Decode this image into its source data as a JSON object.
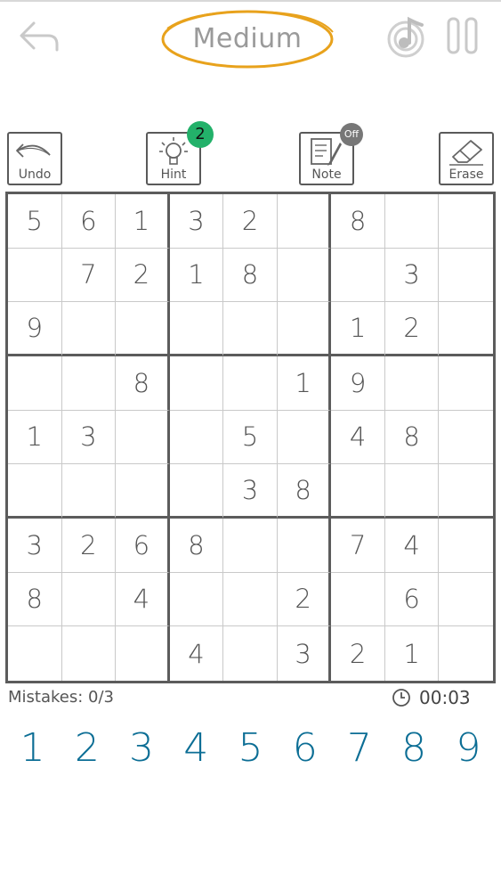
{
  "header": {
    "difficulty": "Medium",
    "accent_color": "#e8a21c",
    "icons": [
      "back-arrow-icon",
      "music-note-icon",
      "pause-icon"
    ]
  },
  "toolbar": {
    "undo_label": "Undo",
    "hint_label": "Hint",
    "hint_count": "2",
    "note_label": "Note",
    "note_state": "Off",
    "erase_label": "Erase",
    "badge_color": "#23b16a"
  },
  "board": {
    "rows": [
      [
        "5",
        "6",
        "1",
        "3",
        "2",
        "",
        "8",
        "",
        ""
      ],
      [
        "",
        "7",
        "2",
        "1",
        "8",
        "",
        "",
        "3",
        ""
      ],
      [
        "9",
        "",
        "",
        "",
        "",
        "",
        "1",
        "2",
        ""
      ],
      [
        "",
        "",
        "8",
        "",
        "",
        "1",
        "9",
        "",
        ""
      ],
      [
        "1",
        "3",
        "",
        "",
        "5",
        "",
        "4",
        "8",
        ""
      ],
      [
        "",
        "",
        "",
        "",
        "3",
        "8",
        "",
        "",
        ""
      ],
      [
        "3",
        "2",
        "6",
        "8",
        "",
        "",
        "7",
        "4",
        ""
      ],
      [
        "8",
        "",
        "4",
        "",
        "",
        "2",
        "",
        "6",
        ""
      ],
      [
        "",
        "",
        "",
        "4",
        "",
        "3",
        "2",
        "1",
        ""
      ]
    ]
  },
  "status": {
    "mistakes": "Mistakes: 0/3",
    "timer": "00:03"
  },
  "numpad": {
    "numbers": [
      "1",
      "2",
      "3",
      "4",
      "5",
      "6",
      "7",
      "8",
      "9"
    ],
    "color": "#0c6e95"
  }
}
